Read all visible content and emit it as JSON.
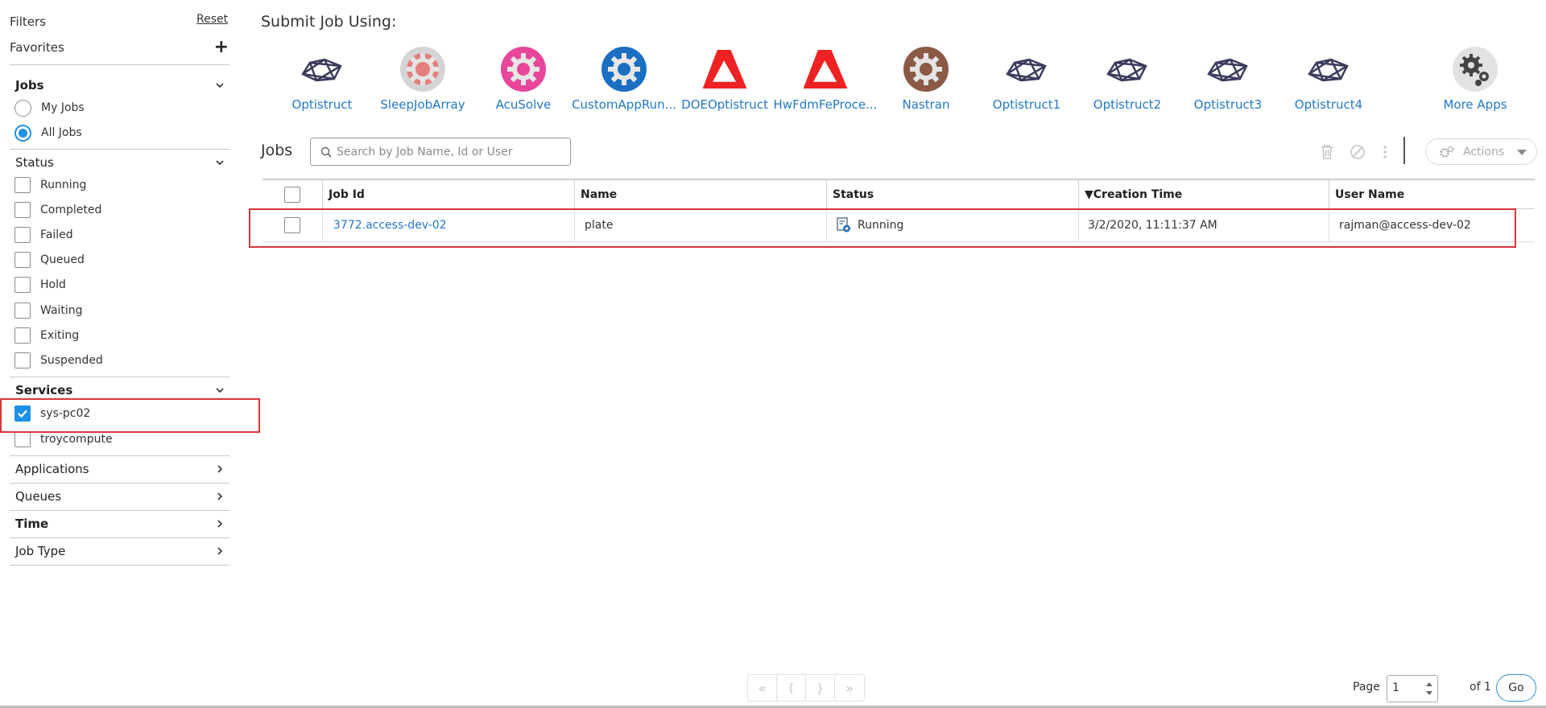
{
  "sidebar": {
    "filters_label": "Filters",
    "reset_label": "Reset",
    "favorites_label": "Favorites",
    "favorites_add_icon": "plus-icon",
    "jobs": {
      "title": "Jobs",
      "options": [
        {
          "label": "My Jobs",
          "selected": false
        },
        {
          "label": "All Jobs",
          "selected": true
        }
      ]
    },
    "status": {
      "title": "Status",
      "options": [
        "Running",
        "Completed",
        "Failed",
        "Queued",
        "Hold",
        "Waiting",
        "Exiting",
        "Suspended"
      ]
    },
    "services": {
      "title": "Services",
      "options": [
        {
          "label": "sys-pc02",
          "checked": true
        },
        {
          "label": "troycompute",
          "checked": false
        }
      ]
    },
    "collapsed_sections": [
      "Applications",
      "Queues",
      "Time",
      "Job Type"
    ]
  },
  "submit": {
    "title": "Submit Job Using:",
    "apps": [
      {
        "label": "Optistruct",
        "icon": "truss-icon"
      },
      {
        "label": "SleepJobArray",
        "icon": "gear-icon",
        "color": "#e57f7f"
      },
      {
        "label": "AcuSolve",
        "icon": "gear-icon",
        "color": "#e8469b"
      },
      {
        "label": "CustomAppRun...",
        "icon": "gear-icon",
        "color": "#1a6fc2"
      },
      {
        "label": "DOEOptistruct",
        "icon": "altair-logo-icon",
        "color": "#ee2222"
      },
      {
        "label": "HwFdmFeProce...",
        "icon": "altair-logo-icon",
        "color": "#ee2222"
      },
      {
        "label": "Nastran",
        "icon": "gear-icon",
        "color": "#8a5a45"
      },
      {
        "label": "Optistruct1",
        "icon": "truss-icon"
      },
      {
        "label": "Optistruct2",
        "icon": "truss-icon"
      },
      {
        "label": "Optistruct3",
        "icon": "truss-icon"
      },
      {
        "label": "Optistruct4",
        "icon": "truss-icon"
      }
    ],
    "more_apps_label": "More Apps"
  },
  "jobs_panel": {
    "title": "Jobs",
    "search_placeholder": "Search by Job Name, Id or User",
    "actions_label": "Actions",
    "columns": [
      "Job Id",
      "Name",
      "Status",
      "▼Creation Time",
      "User Name"
    ],
    "rows": [
      {
        "job_id": "3772.access-dev-02",
        "name": "plate",
        "status": "Running",
        "creation_time": "3/2/2020, 11:11:37 AM",
        "user_name": "rajman@access-dev-02"
      }
    ]
  },
  "pagination": {
    "page_label": "Page",
    "current_page": "1",
    "of_label": "of 1",
    "go_label": "Go",
    "nav": [
      "«",
      "⟨",
      "⟩",
      "»"
    ]
  },
  "colors": {
    "accent": "#1e90e8",
    "link": "#2278c8",
    "highlight": "#d9353a"
  }
}
